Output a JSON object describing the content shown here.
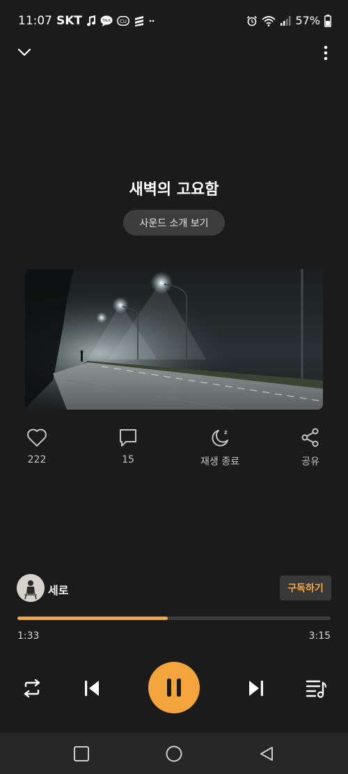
{
  "status_bar": {
    "time": "11:07",
    "carrier": "SKT",
    "notification_icons": [
      "music-note-icon",
      "kakaotalk-icon",
      "cu-icon",
      "app-icon",
      "more-notifications-icon"
    ],
    "battery": "57%"
  },
  "track": {
    "title": "새벽의 고요함",
    "intro_button": "사운드 소개 보기"
  },
  "actions": {
    "like_count": "222",
    "comment_count": "15",
    "sleep_timer_label": "재생 종료",
    "share_label": "공유"
  },
  "artist": {
    "name": "세로",
    "subscribe_label": "구독하기"
  },
  "playback": {
    "current_time": "1:33",
    "total_time": "3:15",
    "progress_fraction": 0.48,
    "is_playing": true
  },
  "colors": {
    "background": "#1b1b1b",
    "accent": "#f4a741",
    "nav_bar": "#272727"
  }
}
